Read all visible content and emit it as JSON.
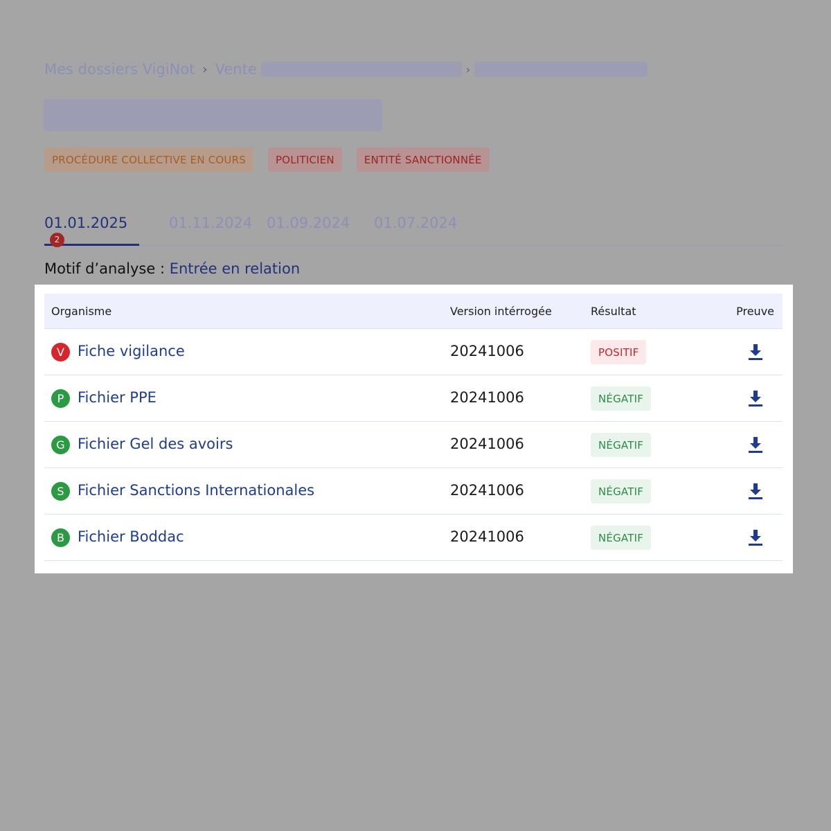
{
  "breadcrumb": {
    "root": "Mes dossiers VigiNot",
    "second": "Vente"
  },
  "badges": [
    {
      "label": "PROCÉDURE COLLECTIVE EN COURS",
      "tone": "orange"
    },
    {
      "label": "POLITICIEN",
      "tone": "red"
    },
    {
      "label": "ENTITÉ SANCTIONNÉE",
      "tone": "red"
    }
  ],
  "tabs": [
    {
      "label": "01.01.2025",
      "count": "2",
      "active": true
    },
    {
      "label": "01.11.2024"
    },
    {
      "label": "01.09.2024"
    },
    {
      "label": "01.07.2024"
    }
  ],
  "motif": {
    "label": "Motif d’analyse :",
    "value": "Entrée en relation"
  },
  "table": {
    "headers": {
      "organisme": "Organisme",
      "version": "Version intérrogée",
      "resultat": "Résultat",
      "preuve": "Preuve"
    },
    "rows": [
      {
        "letter": "V",
        "name": "Fiche vigilance",
        "version": "20241006",
        "result": "POSITIF",
        "status": "positive"
      },
      {
        "letter": "P",
        "name": "Fichier PPE",
        "version": "20241006",
        "result": "NÉGATIF",
        "status": "negative"
      },
      {
        "letter": "G",
        "name": "Fichier Gel des avoirs",
        "version": "20241006",
        "result": "NÉGATIF",
        "status": "negative"
      },
      {
        "letter": "S",
        "name": "Fichier Sanctions Internationales",
        "version": "20241006",
        "result": "NÉGATIF",
        "status": "negative"
      },
      {
        "letter": "B",
        "name": "Fichier Boddac",
        "version": "20241006",
        "result": "NÉGATIF",
        "status": "negative"
      }
    ]
  },
  "colors": {
    "accent": "#233278",
    "link": "#1f3d8c",
    "positive": "#c9232b",
    "negative": "#2d8a45",
    "overlay": "#a5a5a5"
  }
}
